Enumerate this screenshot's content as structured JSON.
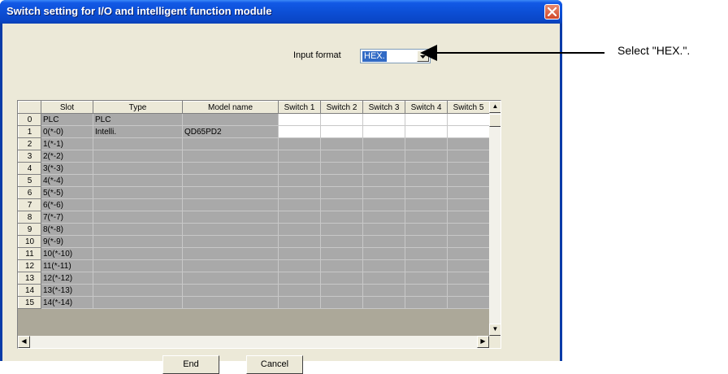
{
  "window": {
    "title": "Switch setting for I/O and intelligent function module"
  },
  "input_format": {
    "label": "Input format",
    "value": "HEX."
  },
  "grid": {
    "columns": [
      "",
      "Slot",
      "Type",
      "Model name",
      "Switch 1",
      "Switch 2",
      "Switch 3",
      "Switch 4",
      "Switch 5"
    ],
    "rows": [
      {
        "num": "0",
        "slot": "PLC",
        "type": "PLC",
        "model": ""
      },
      {
        "num": "1",
        "slot": "0(*-0)",
        "type": "Intelli.",
        "model": "QD65PD2"
      },
      {
        "num": "2",
        "slot": "1(*-1)",
        "type": "",
        "model": ""
      },
      {
        "num": "3",
        "slot": "2(*-2)",
        "type": "",
        "model": ""
      },
      {
        "num": "4",
        "slot": "3(*-3)",
        "type": "",
        "model": ""
      },
      {
        "num": "5",
        "slot": "4(*-4)",
        "type": "",
        "model": ""
      },
      {
        "num": "6",
        "slot": "5(*-5)",
        "type": "",
        "model": ""
      },
      {
        "num": "7",
        "slot": "6(*-6)",
        "type": "",
        "model": ""
      },
      {
        "num": "8",
        "slot": "7(*-7)",
        "type": "",
        "model": ""
      },
      {
        "num": "9",
        "slot": "8(*-8)",
        "type": "",
        "model": ""
      },
      {
        "num": "10",
        "slot": "9(*-9)",
        "type": "",
        "model": ""
      },
      {
        "num": "11",
        "slot": "10(*-10)",
        "type": "",
        "model": ""
      },
      {
        "num": "12",
        "slot": "11(*-11)",
        "type": "",
        "model": ""
      },
      {
        "num": "13",
        "slot": "12(*-12)",
        "type": "",
        "model": ""
      },
      {
        "num": "14",
        "slot": "13(*-13)",
        "type": "",
        "model": ""
      },
      {
        "num": "15",
        "slot": "14(*-14)",
        "type": "",
        "model": ""
      }
    ]
  },
  "buttons": {
    "end": "End",
    "cancel": "Cancel"
  },
  "annotation": {
    "text": "Select \"HEX.\"."
  },
  "colors": {
    "titlebar": "#0a46c6",
    "dialog_bg": "#ece9d8",
    "selection": "#316ac5",
    "disabled_cell": "#a9a9a9"
  },
  "icons": {
    "close": "close-x-icon",
    "dropdown": "chevron-down-icon"
  }
}
